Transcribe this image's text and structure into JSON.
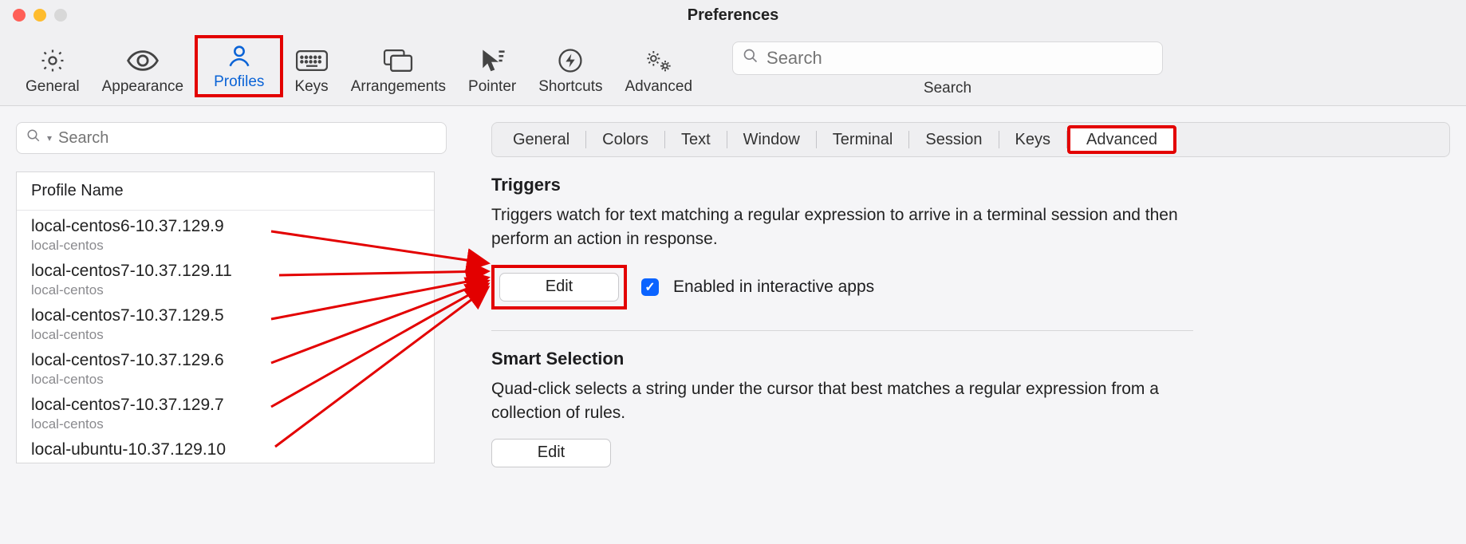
{
  "window": {
    "title": "Preferences"
  },
  "toolbar": {
    "items": [
      {
        "label": "General"
      },
      {
        "label": "Appearance"
      },
      {
        "label": "Profiles"
      },
      {
        "label": "Keys"
      },
      {
        "label": "Arrangements"
      },
      {
        "label": "Pointer"
      },
      {
        "label": "Shortcuts"
      },
      {
        "label": "Advanced"
      }
    ],
    "search_placeholder": "Search",
    "search_label": "Search"
  },
  "left": {
    "search_placeholder": "Search",
    "header": "Profile Name",
    "profiles": [
      {
        "name": "local-centos6-10.37.129.9",
        "tag": "local-centos"
      },
      {
        "name": "local-centos7-10.37.129.11",
        "tag": "local-centos"
      },
      {
        "name": "local-centos7-10.37.129.5",
        "tag": "local-centos"
      },
      {
        "name": "local-centos7-10.37.129.6",
        "tag": "local-centos"
      },
      {
        "name": "local-centos7-10.37.129.7",
        "tag": "local-centos"
      },
      {
        "name": "local-ubuntu-10.37.129.10",
        "tag": ""
      }
    ]
  },
  "right": {
    "subtabs": [
      "General",
      "Colors",
      "Text",
      "Window",
      "Terminal",
      "Session",
      "Keys",
      "Advanced"
    ],
    "triggers": {
      "title": "Triggers",
      "desc": "Triggers watch for text matching a regular expression to arrive in a terminal session and then perform an action in response.",
      "edit": "Edit",
      "checkbox_label": "Enabled in interactive apps",
      "checkbox_checked": true
    },
    "smart": {
      "title": "Smart Selection",
      "desc": "Quad-click selects a string under the cursor that best matches a regular expression from a collection of rules.",
      "edit": "Edit"
    }
  },
  "annotations": {
    "highlighted_toolbar_item": "Profiles",
    "highlighted_subtab": "Advanced",
    "highlighted_button": "Edit",
    "arrows_from_profiles_to_edit": true
  }
}
